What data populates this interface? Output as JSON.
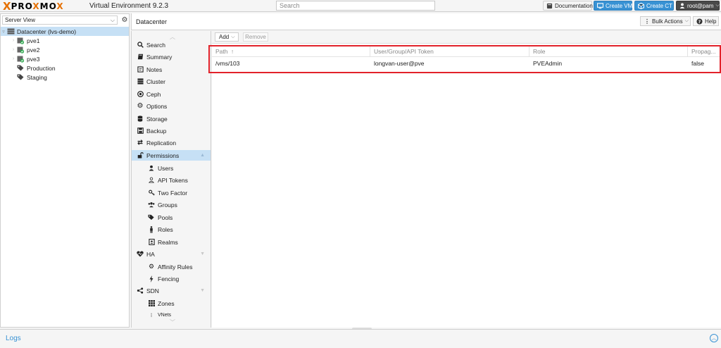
{
  "app": {
    "brand_x": "X",
    "brand_word_1": "PRO",
    "brand_word_2": "X",
    "brand_word_3": "M",
    "brand_word_4": "O",
    "brand_word_5": "X",
    "title": "Virtual Environment 9.2.3"
  },
  "topbar": {
    "search_placeholder": "Search",
    "documentation_label": "Documentation",
    "create_vm_label": "Create VM",
    "create_ct_label": "Create CT",
    "user_label": "root@pam"
  },
  "tree": {
    "view_label": "Server View",
    "items": [
      {
        "label": "Datacenter (lvs-demo)",
        "icon": "datacenter-icon"
      },
      {
        "label": "pve1",
        "icon": "node-online-icon"
      },
      {
        "label": "pve2",
        "icon": "node-online-icon"
      },
      {
        "label": "pve3",
        "icon": "node-online-icon"
      },
      {
        "label": "Production",
        "icon": "tag-icon"
      },
      {
        "label": "Staging",
        "icon": "tag-icon"
      }
    ]
  },
  "header": {
    "title": "Datacenter",
    "bulk_actions_label": "Bulk Actions",
    "help_label": "Help"
  },
  "nav": {
    "items": [
      {
        "label": "Search",
        "icon": "search-icon"
      },
      {
        "label": "Summary",
        "icon": "book-icon"
      },
      {
        "label": "Notes",
        "icon": "notes-icon"
      },
      {
        "label": "Cluster",
        "icon": "server-icon"
      },
      {
        "label": "Ceph",
        "icon": "ceph-icon"
      },
      {
        "label": "Options",
        "icon": "gear-icon"
      },
      {
        "label": "Storage",
        "icon": "database-icon"
      },
      {
        "label": "Backup",
        "icon": "floppy-icon"
      },
      {
        "label": "Replication",
        "icon": "retweet-icon"
      },
      {
        "label": "Permissions",
        "icon": "unlock-icon"
      },
      {
        "label": "Users",
        "icon": "user-icon"
      },
      {
        "label": "API Tokens",
        "icon": "user-outline-icon"
      },
      {
        "label": "Two Factor",
        "icon": "key-icon"
      },
      {
        "label": "Groups",
        "icon": "users-icon"
      },
      {
        "label": "Pools",
        "icon": "tags-icon"
      },
      {
        "label": "Roles",
        "icon": "male-icon"
      },
      {
        "label": "Realms",
        "icon": "address-book-icon"
      },
      {
        "label": "HA",
        "icon": "heartbeat-icon"
      },
      {
        "label": "Affinity Rules",
        "icon": "cogs-icon"
      },
      {
        "label": "Fencing",
        "icon": "bolt-icon"
      },
      {
        "label": "SDN",
        "icon": "sdn-icon"
      },
      {
        "label": "Zones",
        "icon": "th-icon"
      },
      {
        "label": "VNets",
        "icon": "vnet-icon"
      }
    ]
  },
  "toolbar": {
    "add_label": "Add",
    "remove_label": "Remove"
  },
  "grid": {
    "columns": [
      "Path",
      "User/Group/API Token",
      "Role",
      "Propag..."
    ],
    "sort_indicator": "↑",
    "rows": [
      [
        "/vms/103",
        "longvan-user@pve",
        "PVEAdmin",
        "false"
      ]
    ]
  },
  "logs": {
    "title": "Logs"
  },
  "colors": {
    "accent": "#3892d4",
    "brand_orange": "#e57000",
    "highlight_red": "#e2222a",
    "selected_bg": "#c6e0f5"
  }
}
